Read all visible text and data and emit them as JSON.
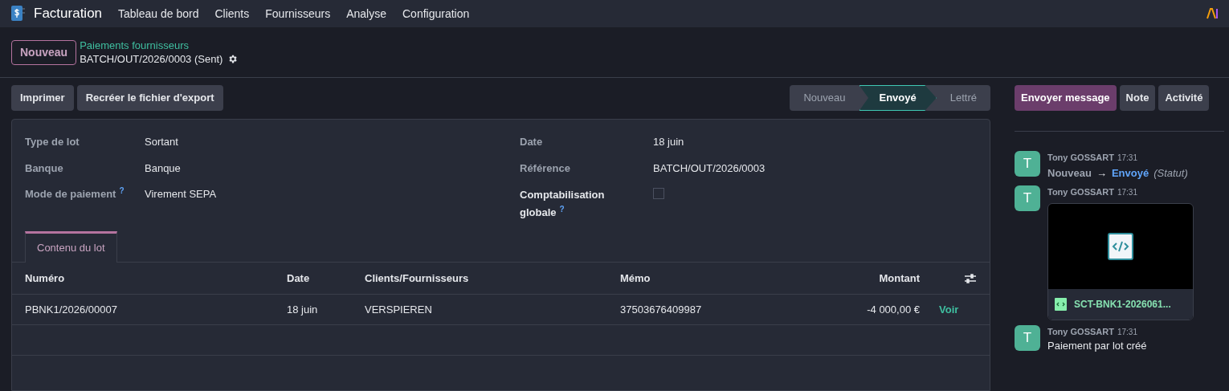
{
  "navbar": {
    "app_name": "Facturation",
    "menu": [
      "Tableau de bord",
      "Clients",
      "Fournisseurs",
      "Analyse",
      "Configuration"
    ]
  },
  "control_panel": {
    "new_button": "Nouveau",
    "breadcrumb": "Paiements fournisseurs",
    "record_title": "BATCH/OUT/2026/0003 (Sent)"
  },
  "actions": [
    "Imprimer",
    "Recréer le fichier d'export"
  ],
  "statusbar": [
    {
      "label": "Nouveau",
      "selected": false
    },
    {
      "label": "Envoyé",
      "selected": true
    },
    {
      "label": "Lettré",
      "selected": false
    }
  ],
  "form": {
    "left": [
      {
        "label": "Type de lot",
        "value": "Sortant"
      },
      {
        "label": "Banque",
        "value": "Banque"
      },
      {
        "label": "Mode de paiement",
        "value": "Virement SEPA",
        "help": "?"
      }
    ],
    "right": [
      {
        "label": "Date",
        "value": "18 juin",
        "kind": "text"
      },
      {
        "label": "Référence",
        "value": "BATCH/OUT/2026/0003",
        "kind": "text"
      },
      {
        "label": "Comptabilisation globale",
        "kind": "checkbox",
        "checked": false,
        "help": "?"
      }
    ]
  },
  "tabs": [
    {
      "label": "Contenu du lot",
      "selected": true
    }
  ],
  "table": {
    "columns": [
      "Numéro",
      "Date",
      "Clients/Fournisseurs",
      "Mémo",
      "Montant"
    ],
    "rows": [
      {
        "cells": [
          "PBNK1/2026/00007",
          "18 juin",
          "VERSPIEREN",
          "37503676409987",
          "-4 000,00 €"
        ],
        "link": "Voir"
      }
    ]
  },
  "chatter": {
    "buttons": [
      {
        "label": "Envoyer message",
        "selected": true
      },
      {
        "label": "Note",
        "selected": false
      },
      {
        "label": "Activité",
        "selected": false
      }
    ],
    "messages": [
      {
        "kind": "tracking",
        "avatar": "T",
        "author": "Tony GOSSART",
        "time": "17:31",
        "old": "Nouveau",
        "arrow": "→",
        "new": "Envoyé",
        "field": "(Statut)"
      },
      {
        "kind": "attachment",
        "avatar": "T",
        "author": "Tony GOSSART",
        "time": "17:31",
        "filename": "SCT-BNK1-2026061..."
      },
      {
        "kind": "text",
        "avatar": "T",
        "author": "Tony GOSSART",
        "time": "17:31",
        "body": "Paiement par lot créé"
      }
    ]
  }
}
